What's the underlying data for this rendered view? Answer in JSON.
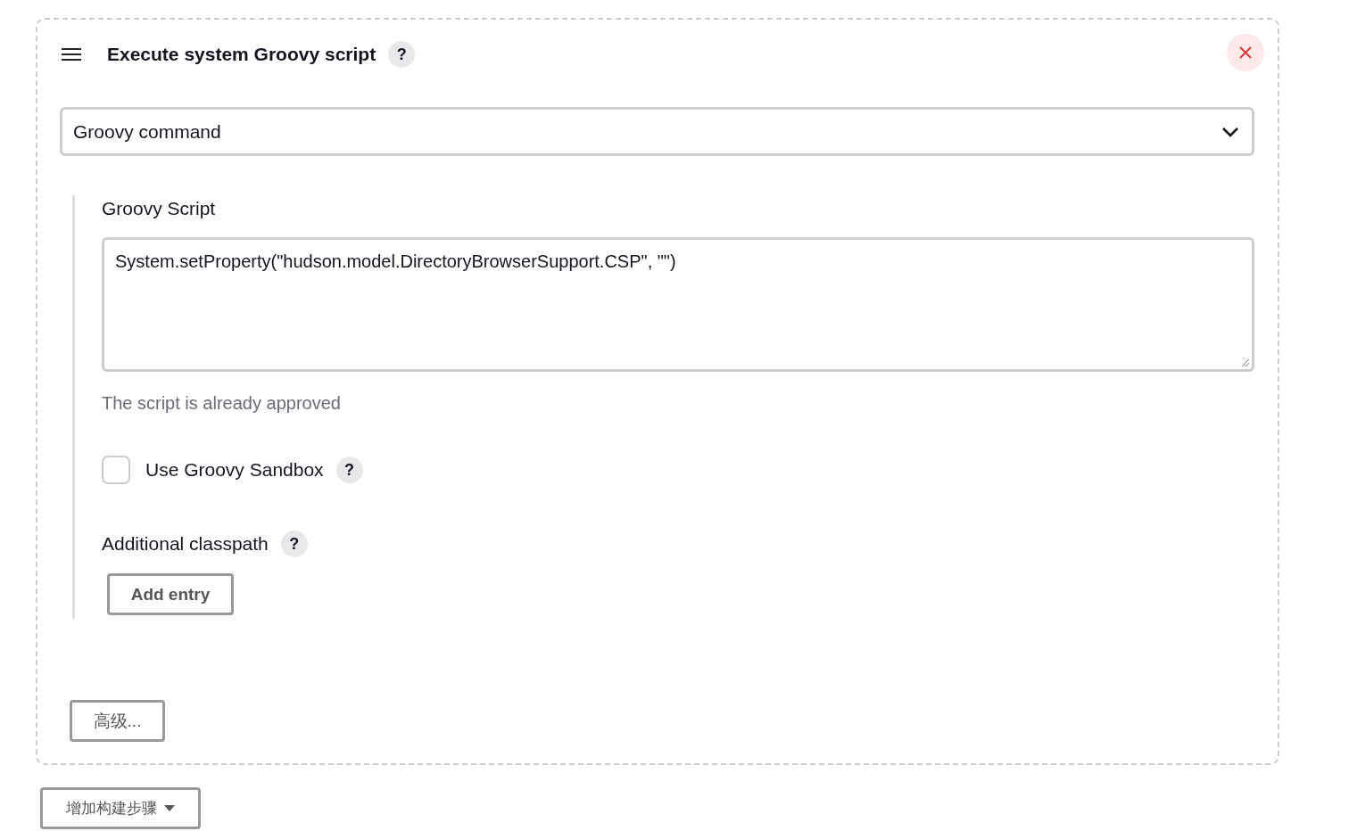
{
  "step": {
    "title": "Execute system Groovy script",
    "help": "?",
    "source": {
      "value": "Groovy command"
    },
    "script": {
      "label": "Groovy Script",
      "value": "System.setProperty(\"hudson.model.DirectoryBrowserSupport.CSP\", \"\")",
      "hint": "The script is already approved"
    },
    "sandbox": {
      "label": "Use Groovy Sandbox",
      "checked": false,
      "help": "?"
    },
    "classpath": {
      "label": "Additional classpath",
      "help": "?",
      "button": "Add entry"
    },
    "advanced_button": "高级..."
  },
  "add_step_button": "增加构建步骤"
}
